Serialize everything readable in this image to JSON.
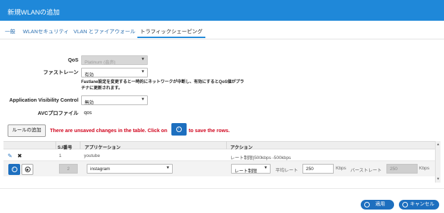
{
  "dialog": {
    "title": "新規WLANの追加"
  },
  "tabs": [
    {
      "label": "一般"
    },
    {
      "label": "WLANセキュリティ"
    },
    {
      "label": "VLAN とファイアウォール"
    },
    {
      "label": "トラフィックシェーピング",
      "active": true
    }
  ],
  "form": {
    "qos": {
      "label": "QoS",
      "value": "Platinum (音声)",
      "disabled": true
    },
    "fastlane": {
      "label": "ファストレーン",
      "value": "有効"
    },
    "fastlane_note": "Fastlane設定を変更すると一時的にネットワークが中断し、有効にするとQoS値がプラチナに更新されます。",
    "avc": {
      "label": "Application Visibility Control",
      "value": "無効"
    },
    "avc_profile": {
      "label": "AVCプロファイル",
      "value": "qos"
    }
  },
  "rules": {
    "add_button": "ルールの追加",
    "warning_pre": "There are unsaved changes in the table. Click on",
    "warning_post": "to save the rows."
  },
  "table": {
    "headers": {
      "actions": "",
      "sno": "S.I番号",
      "app": "アプリケーション",
      "action": "アクション"
    },
    "rows": [
      {
        "sno": "1",
        "app": "youtube",
        "action": "レート制限|500kbps -500kbps"
      }
    ],
    "edit_row": {
      "sno": "2",
      "app": "instagram",
      "action": "レート制限",
      "avg_label": "平均レート",
      "avg_value": "250",
      "avg_unit": "Kbps",
      "burst_label": "バーストレート",
      "burst_value": "250",
      "burst_unit": "Kbps"
    }
  },
  "footer": {
    "apply": "適用",
    "cancel": "キャンセル"
  },
  "colors": {
    "accent": "#1f88d9",
    "primary_button": "#1d6fbf",
    "warning": "#d0021b"
  },
  "icons": {
    "edit": "pencil-icon",
    "delete": "x-icon",
    "save": "save-icon",
    "cancel": "cancel-icon"
  }
}
